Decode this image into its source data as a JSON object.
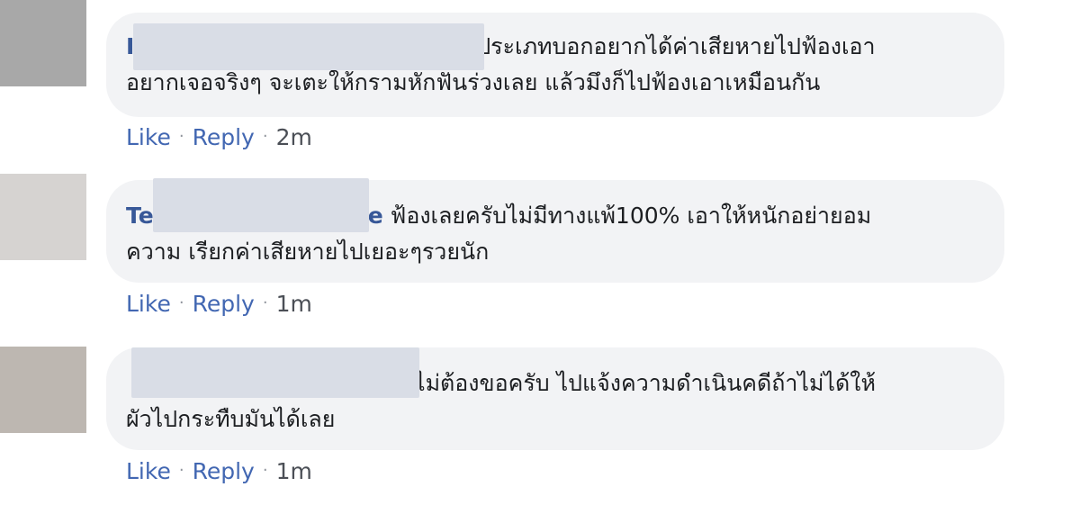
{
  "colors": {
    "bubble_bg": "#f2f3f5",
    "author": "#385898",
    "link": "#4267b2",
    "text": "#1c1e21"
  },
  "comments": [
    {
      "author_visible": "I",
      "line1": "ประเภทบอกอยากได้ค่าเสียหายไปฟ้องเอา",
      "line2": "อยากเจอจริงๆ จะเตะให้กรามหักฟันร่วงเลย แล้วมึงก็ไปฟ้องเอาเหมือนกัน",
      "like": "Like",
      "reply": "Reply",
      "time": "2m",
      "separator": "·"
    },
    {
      "author_visible": "Te",
      "author_visible_tail": "e",
      "line1": "ฟ้องเลยครับไม่มีทางแพ้100% เอาให้หนักอย่ายอม",
      "line2": "ความ เรียกค่าเสียหายไปเยอะๆรวยนัก",
      "like": "Like",
      "reply": "Reply",
      "time": "1m",
      "separator": "·"
    },
    {
      "author_visible": "",
      "line1": "ไม่ต้องขอครับ ไปแจ้งความดำเนินคดีถ้าไม่ได้ให้",
      "line2": "ผัวไปกระทืบมันได้เลย",
      "like": "Like",
      "reply": "Reply",
      "time": "1m",
      "separator": "·"
    }
  ]
}
